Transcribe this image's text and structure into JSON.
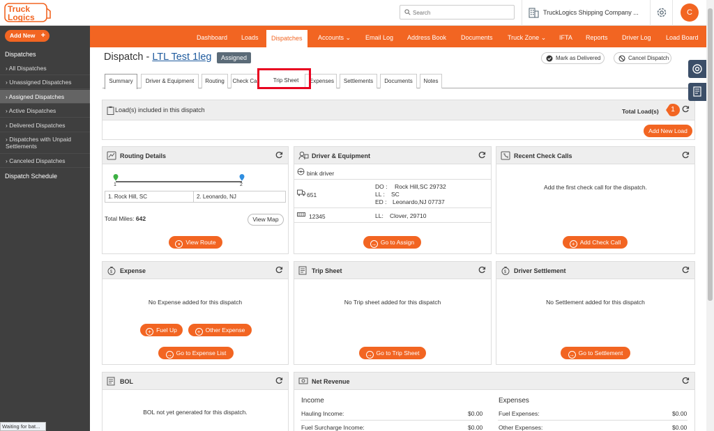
{
  "header": {
    "logo_line1": "Truck",
    "logo_line2": "Logics",
    "search_placeholder": "Search",
    "company": "TruckLogics Shipping Company ...",
    "avatar_initial": "C"
  },
  "sidebar": {
    "add_new": "Add New",
    "section": "Dispatches",
    "items": [
      {
        "label": "All Dispatches"
      },
      {
        "label": "Unassigned Dispatches"
      },
      {
        "label": "Assigned Dispatches"
      },
      {
        "label": "Active Dispatches"
      },
      {
        "label": "Delivered Dispatches"
      },
      {
        "label": "Dispatches with Unpaid Settlements"
      },
      {
        "label": "Canceled Dispatches"
      }
    ],
    "schedule": "Dispatch Schedule"
  },
  "nav": [
    "Dashboard",
    "Loads",
    "Dispatches",
    "Accounts",
    "Email Log",
    "Address Book",
    "Documents",
    "Truck Zone",
    "IFTA",
    "Reports",
    "Driver Log",
    "Load Board"
  ],
  "page": {
    "title_prefix": "Dispatch - ",
    "title_link": "LTL Test 1leg",
    "status": "Assigned",
    "mark_delivered": "Mark as Delivered",
    "cancel_dispatch": "Cancel Dispatch"
  },
  "tabs": [
    "Summary",
    "Driver & Equipment",
    "Routing",
    "Check Ca",
    "Trip Sheet",
    "Expenses",
    "Settlements",
    "Documents",
    "Notes"
  ],
  "loads": {
    "title": "Load(s) included in this dispatch",
    "total_label": "Total Load(s)",
    "total_count": "1",
    "add_button": "Add New Load"
  },
  "routing": {
    "title": "Routing Details",
    "stop1_num": "1",
    "stop2_num": "2",
    "stop1": "1. Rock Hill, SC",
    "stop2": "2. Leonardo, NJ",
    "miles_label": "Total Miles:",
    "miles_value": "642",
    "view_map": "View Map",
    "view_route": "View Route"
  },
  "driver": {
    "title": "Driver & Equipment",
    "name": "bink driver",
    "truck_no": "651",
    "do_label": "DO :",
    "do_value": "Rock Hill,SC 29732",
    "ll_label": "LL :",
    "ll_value": "SC",
    "ed_label": "ED :",
    "ed_value": "Leonardo,NJ 07737",
    "trailer_no": "12345",
    "ll2_label": "LL:",
    "ll2_value": "Clover, 29710",
    "button": "Go to Assign"
  },
  "checkcalls": {
    "title": "Recent Check Calls",
    "empty": "Add the first check call for the dispatch.",
    "button": "Add Check Call"
  },
  "expense": {
    "title": "Expense",
    "empty": "No Expense added for this dispatch",
    "fuel_up": "Fuel Up",
    "other_expense": "Other Expense",
    "go_list": "Go to Expense List"
  },
  "tripsheet": {
    "title": "Trip Sheet",
    "empty": "No Trip sheet added for this dispatch",
    "button": "Go to Trip Sheet"
  },
  "settlement": {
    "title": "Driver Settlement",
    "empty": "No Settlement added for this dispatch",
    "button": "Go to Settlement"
  },
  "bol": {
    "title": "BOL",
    "empty": "BOL not yet generated for this dispatch."
  },
  "revenue": {
    "title": "Net Revenue",
    "income_head": "Income",
    "expenses_head": "Expenses",
    "income": [
      {
        "label": "Hauling Income:",
        "value": "$0.00"
      },
      {
        "label": "Fuel Surcharge Income:",
        "value": "$0.00"
      }
    ],
    "expenses": [
      {
        "label": "Fuel Expenses:",
        "value": "$0.00"
      },
      {
        "label": "Other Expenses:",
        "value": "$0.00"
      }
    ]
  },
  "statusbar": "Waiting for bat...",
  "colors": {
    "accent": "#f26522",
    "sidebar": "#3f3f3f",
    "link": "#1f5b9e",
    "highlight": "#e8001f"
  }
}
